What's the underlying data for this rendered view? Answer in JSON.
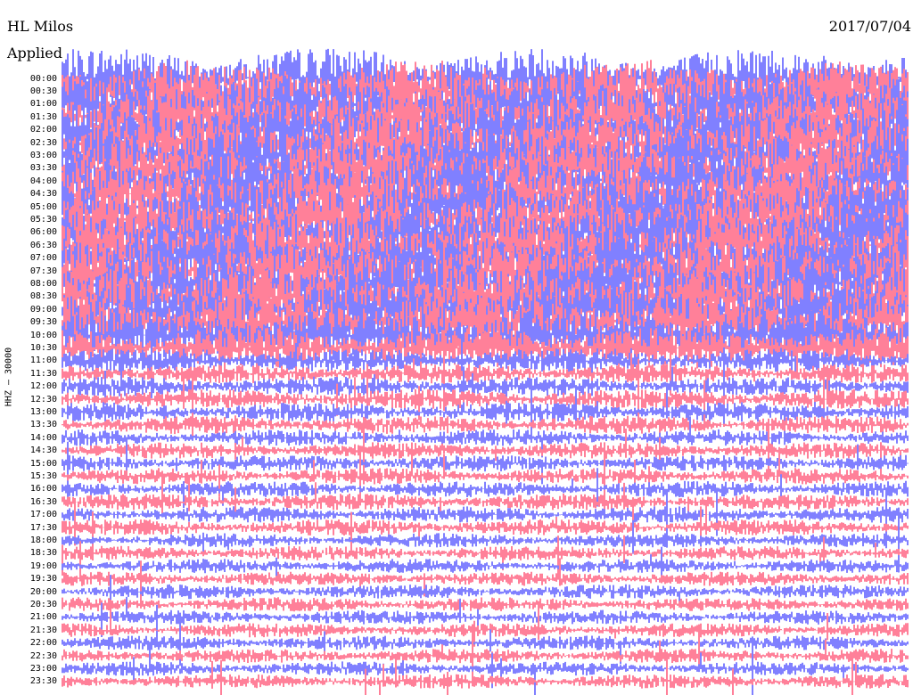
{
  "chart_data": {
    "type": "line",
    "chart_kind": "helicorder",
    "header": {
      "station": "HL Milos",
      "filter": "Applied",
      "date": "2017/07/04"
    },
    "channel_label": "HHZ – 30000",
    "row_interval_minutes": 30,
    "series_colors": [
      "#0000ff",
      "#ff0033"
    ],
    "background": "#ffffff",
    "grid": false,
    "y_ticks": [
      "00:00",
      "00:30",
      "01:00",
      "01:30",
      "02:00",
      "02:30",
      "03:00",
      "03:30",
      "04:00",
      "04:30",
      "05:00",
      "05:30",
      "06:00",
      "06:30",
      "07:00",
      "07:30",
      "08:00",
      "08:30",
      "09:00",
      "09:30",
      "10:00",
      "10:30",
      "11:00",
      "11:30",
      "12:00",
      "12:30",
      "13:00",
      "13:30",
      "14:00",
      "14:30",
      "15:00",
      "15:30",
      "16:00",
      "16:30",
      "17:00",
      "17:30",
      "18:00",
      "18:30",
      "19:00",
      "19:30",
      "20:00",
      "20:30",
      "21:00",
      "21:30",
      "22:00",
      "22:30",
      "23:00",
      "23:30"
    ],
    "rows": [
      {
        "time": "00:00",
        "level": 0.95
      },
      {
        "time": "00:30",
        "level": 0.95
      },
      {
        "time": "01:00",
        "level": 0.95
      },
      {
        "time": "01:30",
        "level": 0.95
      },
      {
        "time": "02:00",
        "level": 0.95
      },
      {
        "time": "02:30",
        "level": 0.95
      },
      {
        "time": "03:00",
        "level": 0.95
      },
      {
        "time": "03:30",
        "level": 0.95
      },
      {
        "time": "04:00",
        "level": 0.95
      },
      {
        "time": "04:30",
        "level": 0.95
      },
      {
        "time": "05:00",
        "level": 0.95
      },
      {
        "time": "05:30",
        "level": 0.95
      },
      {
        "time": "06:00",
        "level": 0.95
      },
      {
        "time": "06:30",
        "level": 0.95
      },
      {
        "time": "07:00",
        "level": 0.95
      },
      {
        "time": "07:30",
        "level": 0.95
      },
      {
        "time": "08:00",
        "level": 0.95
      },
      {
        "time": "08:30",
        "level": 0.95
      },
      {
        "time": "09:00",
        "level": 0.95
      },
      {
        "time": "09:30",
        "level": 0.95
      },
      {
        "time": "10:00",
        "level": 0.85
      },
      {
        "time": "10:30",
        "level": 0.65
      },
      {
        "time": "11:00",
        "level": 0.35
      },
      {
        "time": "11:30",
        "level": 0.3
      },
      {
        "time": "12:00",
        "level": 0.3
      },
      {
        "time": "12:30",
        "level": 0.3
      },
      {
        "time": "13:00",
        "level": 0.3
      },
      {
        "time": "13:30",
        "level": 0.28
      },
      {
        "time": "14:00",
        "level": 0.25
      },
      {
        "time": "14:30",
        "level": 0.25
      },
      {
        "time": "15:00",
        "level": 0.25
      },
      {
        "time": "15:30",
        "level": 0.25
      },
      {
        "time": "16:00",
        "level": 0.25
      },
      {
        "time": "16:30",
        "level": 0.25
      },
      {
        "time": "17:00",
        "level": 0.25
      },
      {
        "time": "17:30",
        "level": 0.25
      },
      {
        "time": "18:00",
        "level": 0.22
      },
      {
        "time": "18:30",
        "level": 0.22
      },
      {
        "time": "19:00",
        "level": 0.22
      },
      {
        "time": "19:30",
        "level": 0.22
      },
      {
        "time": "20:00",
        "level": 0.22
      },
      {
        "time": "20:30",
        "level": 0.22
      },
      {
        "time": "21:00",
        "level": 0.22
      },
      {
        "time": "21:30",
        "level": 0.22
      },
      {
        "time": "22:00",
        "level": 0.22
      },
      {
        "time": "22:30",
        "level": 0.22
      },
      {
        "time": "23:00",
        "level": 0.22
      },
      {
        "time": "23:30",
        "level": 0.22
      }
    ]
  }
}
